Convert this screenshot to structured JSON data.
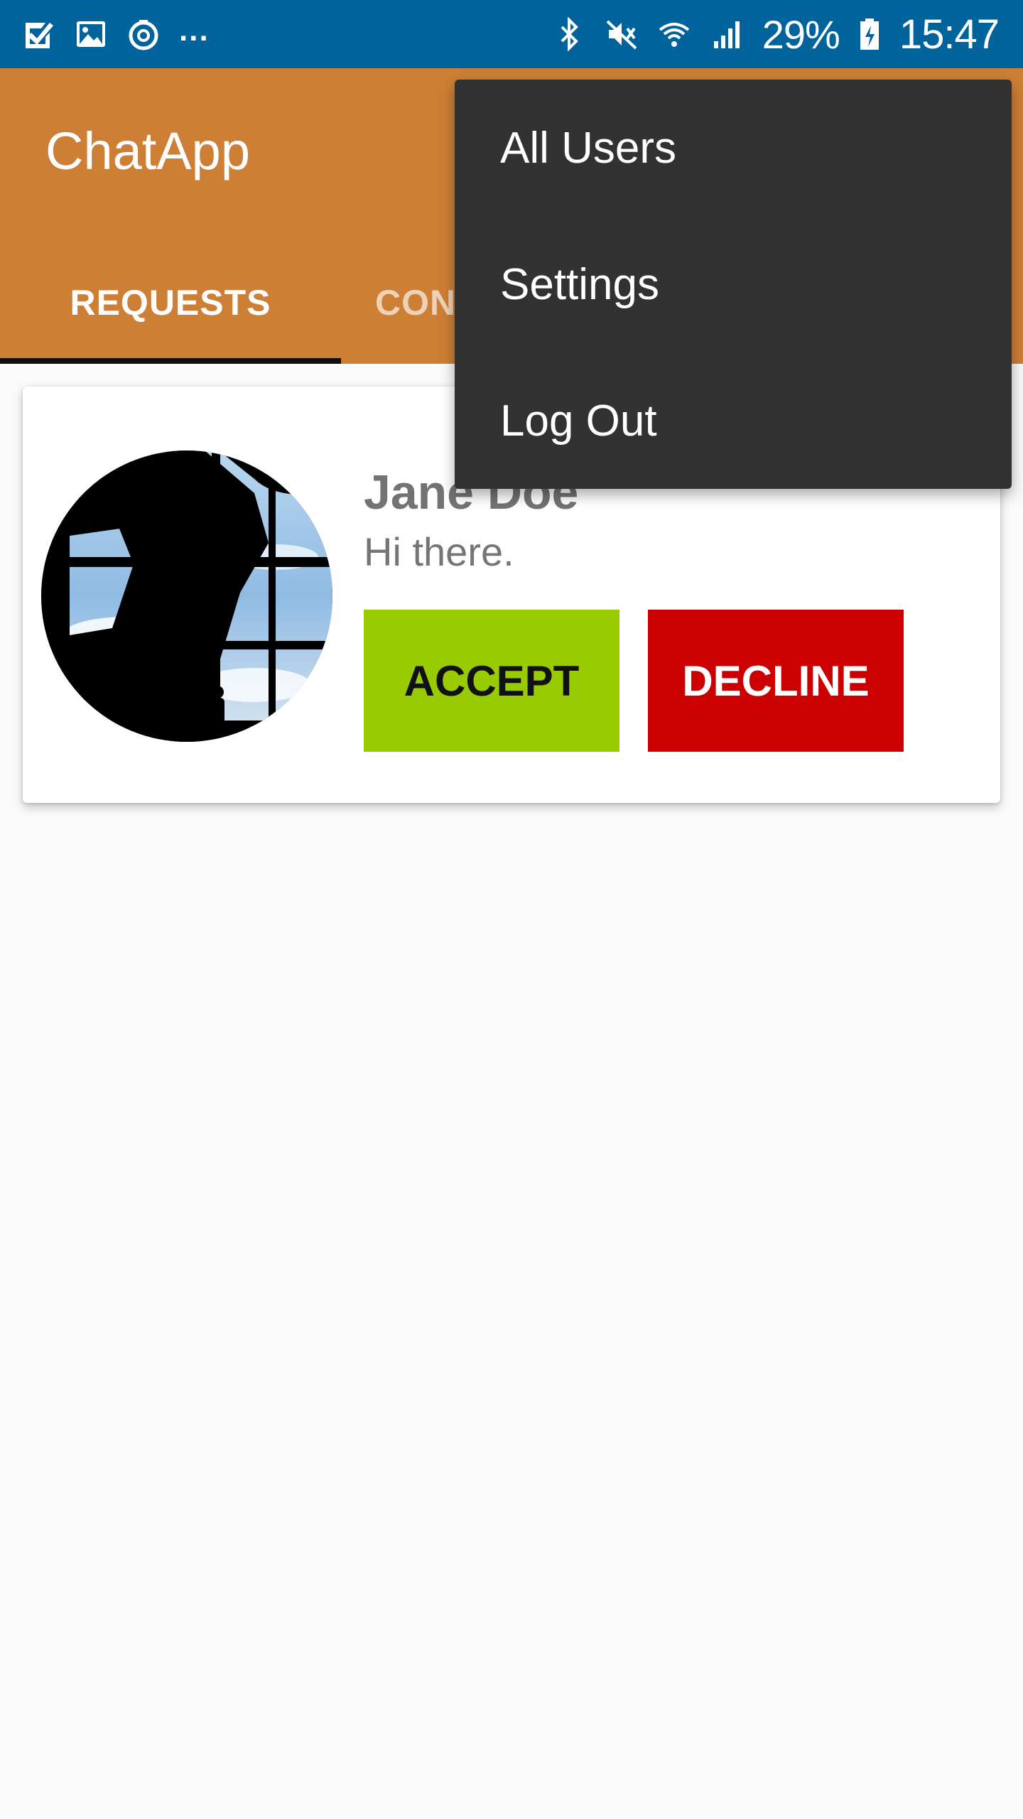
{
  "status_bar": {
    "left_icons": [
      "checkbox-icon",
      "image-icon",
      "sync-icon"
    ],
    "ellipsis": "...",
    "right_icons": [
      "bluetooth-icon",
      "mute-icon",
      "wifi-icon",
      "signal-icon"
    ],
    "battery": "29%",
    "time": "15:47"
  },
  "app": {
    "title": "ChatApp",
    "theme_color": "#cd7f35",
    "status_bar_color": "#01639b"
  },
  "tabs": [
    {
      "label": "REQUESTS",
      "selected": true
    },
    {
      "label": "CONV",
      "selected": false
    }
  ],
  "request": {
    "name": "Jane Doe",
    "message": "Hi there.",
    "accept_label": "ACCEPT",
    "decline_label": "DECLINE",
    "accept_color": "#99cc00",
    "decline_color": "#cc0000"
  },
  "menu": {
    "items": [
      "All Users",
      "Settings",
      "Log Out"
    ]
  }
}
